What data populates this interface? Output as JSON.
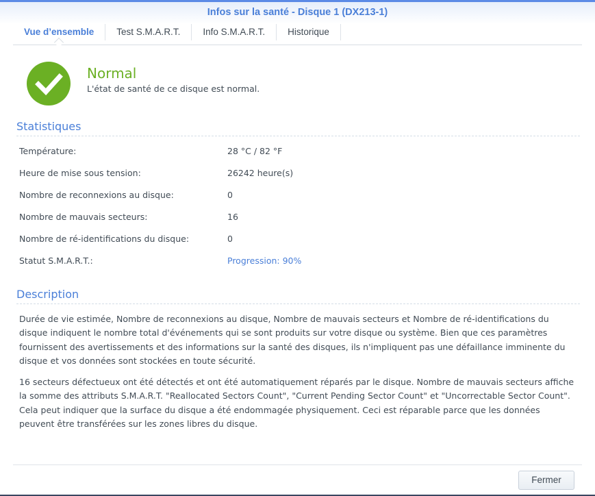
{
  "window": {
    "title": "Infos sur la santé - Disque 1 (DX213-1)"
  },
  "tabs": [
    {
      "label": "Vue d’ensemble"
    },
    {
      "label": "Test S.M.A.R.T."
    },
    {
      "label": "Info S.M.A.R.T."
    },
    {
      "label": "Historique"
    }
  ],
  "status": {
    "title": "Normal",
    "description": "L'état de santé de ce disque est normal.",
    "color": "#6bb024"
  },
  "stats": {
    "heading": "Statistiques",
    "rows": [
      {
        "label": "Température:",
        "value": "28 °C / 82 °F"
      },
      {
        "label": "Heure de mise sous tension:",
        "value": "26242 heure(s)"
      },
      {
        "label": "Nombre de reconnexions au disque:",
        "value": "0"
      },
      {
        "label": "Nombre de mauvais secteurs:",
        "value": "16"
      },
      {
        "label": "Nombre de ré-identifications du disque:",
        "value": "0"
      },
      {
        "label": "Statut S.M.A.R.T.:",
        "value": "Progression: 90%"
      }
    ]
  },
  "description": {
    "heading": "Description",
    "paragraphs": [
      "Durée de vie estimée, Nombre de reconnexions au disque, Nombre de mauvais secteurs et Nombre de ré-identifications du disque indiquent le nombre total d'événements qui se sont produits sur votre disque ou système. Bien que ces paramètres fournissent des avertissements et des informations sur la santé des disques, ils n'impliquent pas une défaillance imminente du disque et vos données sont stockées en toute sécurité.",
      "16 secteurs défectueux ont été détectés et ont été automatiquement réparés par le disque. Nombre de mauvais secteurs affiche la somme des attributs S.M.A.R.T. \"Reallocated Sectors Count\", \"Current Pending Sector Count\" et \"Uncorrectable Sector Count\". Cela peut indiquer que la surface du disque a été endommagée physiquement. Ceci est réparable parce que les données peuvent être transférées sur les zones libres du disque."
    ]
  },
  "footer": {
    "close_label": "Fermer"
  }
}
